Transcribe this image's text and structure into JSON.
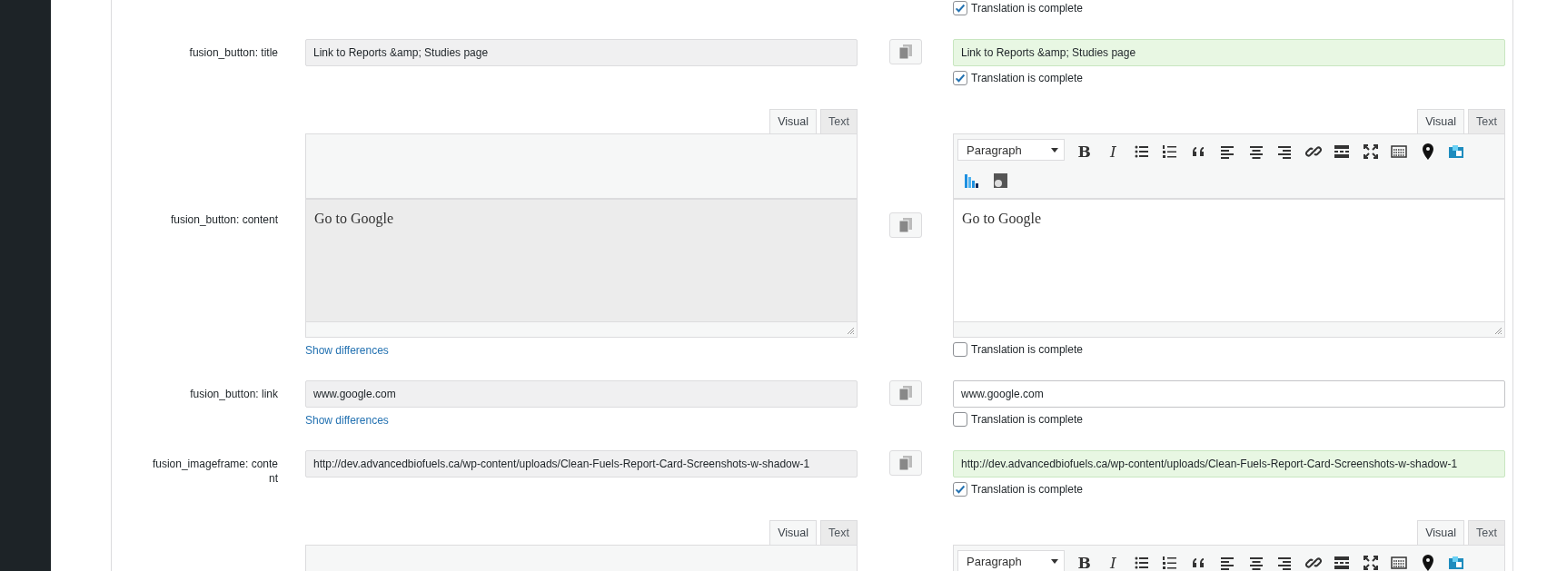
{
  "previous_row": {
    "complete": {
      "label": "Translation is complete",
      "checked": true
    }
  },
  "fields": [
    {
      "kind": "text",
      "label": "fusion_button: title",
      "original": "Link to Reports &amp; Studies page",
      "translation": "Link to Reports &amp; Studies page",
      "complete": {
        "label": "Translation is complete",
        "checked": true
      }
    },
    {
      "kind": "editor",
      "label": "fusion_button: content",
      "original": "Go to Google",
      "original_tabs": [
        {
          "label": "Visual",
          "selected": true
        },
        {
          "label": "Text",
          "selected": false
        }
      ],
      "translation": "Go to Google",
      "translation_tabs": [
        {
          "label": "Visual",
          "selected": true
        },
        {
          "label": "Text",
          "selected": false
        }
      ],
      "toolbar": {
        "format": "Paragraph",
        "buttons": [
          {
            "kind": "bold",
            "glyph": "B"
          },
          {
            "kind": "italic",
            "glyph": "I"
          },
          {
            "kind": "bullets"
          },
          {
            "kind": "numbers"
          },
          {
            "kind": "quote"
          },
          {
            "kind": "align-left"
          },
          {
            "kind": "align-center"
          },
          {
            "kind": "align-right"
          },
          {
            "kind": "link"
          },
          {
            "kind": "more"
          },
          {
            "kind": "fullscreen"
          },
          {
            "kind": "keyboard"
          },
          {
            "kind": "pin"
          },
          {
            "kind": "plugin"
          },
          {
            "kind": "chart"
          },
          {
            "kind": "gplugin"
          }
        ]
      },
      "show_differences": "Show differences",
      "complete": {
        "label": "Translation is complete",
        "checked": false
      }
    },
    {
      "kind": "text",
      "label": "fusion_button: link",
      "original": "www.google.com",
      "translation": "www.google.com",
      "show_differences": "Show differences",
      "complete": {
        "label": "Translation is complete",
        "checked": false
      }
    },
    {
      "kind": "text",
      "label": "fusion_imageframe: content",
      "original": "http://dev.advancedbiofuels.ca/wp-content/uploads/Clean-Fuels-Report-Card-Screenshots-w-shadow-1",
      "translation": "http://dev.advancedbiofuels.ca/wp-content/uploads/Clean-Fuels-Report-Card-Screenshots-w-shadow-1",
      "complete": {
        "label": "Translation is complete",
        "checked": true
      }
    }
  ],
  "next_editor": {
    "original_tabs": [
      {
        "label": "Visual",
        "selected": true
      },
      {
        "label": "Text",
        "selected": false
      }
    ],
    "translation_tabs": [
      {
        "label": "Visual",
        "selected": true
      },
      {
        "label": "Text",
        "selected": false
      }
    ],
    "toolbar": {
      "format": "Paragraph",
      "buttons": [
        {
          "kind": "bold",
          "glyph": "B"
        },
        {
          "kind": "italic",
          "glyph": "I"
        },
        {
          "kind": "bullets"
        },
        {
          "kind": "numbers"
        },
        {
          "kind": "quote"
        },
        {
          "kind": "align-left"
        },
        {
          "kind": "align-center"
        },
        {
          "kind": "align-right"
        },
        {
          "kind": "link"
        },
        {
          "kind": "more"
        },
        {
          "kind": "fullscreen"
        },
        {
          "kind": "keyboard"
        },
        {
          "kind": "pin"
        },
        {
          "kind": "plugin"
        }
      ]
    }
  }
}
